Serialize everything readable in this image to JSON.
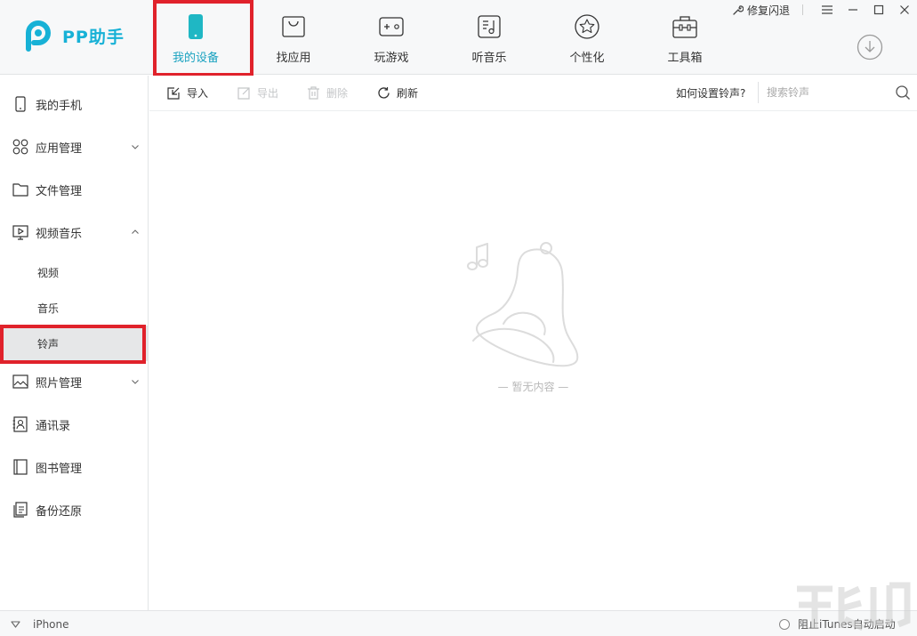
{
  "app": {
    "name": "PP助手"
  },
  "window": {
    "repair_label": "修复闪退"
  },
  "nav": [
    {
      "id": "my-device",
      "label": "我的设备",
      "icon": "phone-icon",
      "active": true
    },
    {
      "id": "find-apps",
      "label": "找应用",
      "icon": "shopping-bag-icon",
      "active": false
    },
    {
      "id": "games",
      "label": "玩游戏",
      "icon": "gamepad-icon",
      "active": false
    },
    {
      "id": "music",
      "label": "听音乐",
      "icon": "music-icon",
      "active": false
    },
    {
      "id": "personalize",
      "label": "个性化",
      "icon": "star-icon",
      "active": false
    },
    {
      "id": "toolbox",
      "label": "工具箱",
      "icon": "toolbox-icon",
      "active": false
    }
  ],
  "sidebar": {
    "items": [
      {
        "label": "我的手机",
        "icon": "phone-outline-icon"
      },
      {
        "label": "应用管理",
        "icon": "apps-grid-icon",
        "expandable": true
      },
      {
        "label": "文件管理",
        "icon": "folder-icon"
      },
      {
        "label": "视频音乐",
        "icon": "media-icon",
        "expanded": true
      },
      {
        "label": "照片管理",
        "icon": "image-icon",
        "expandable": true
      },
      {
        "label": "通讯录",
        "icon": "contacts-icon"
      },
      {
        "label": "图书管理",
        "icon": "book-icon"
      },
      {
        "label": "备份还原",
        "icon": "backup-icon"
      }
    ],
    "subitems": [
      {
        "label": "视频"
      },
      {
        "label": "音乐"
      },
      {
        "label": "铃声",
        "active": true
      }
    ]
  },
  "toolbar": {
    "import": "导入",
    "export": "导出",
    "delete": "删除",
    "refresh": "刷新",
    "howto": "如何设置铃声?",
    "search_placeholder": "搜索铃声"
  },
  "main": {
    "empty_text": "— 暂无内容 —"
  },
  "status": {
    "device": "iPhone",
    "itunes": "阻止iTunes自动启动"
  },
  "colors": {
    "accent": "#17b1d6",
    "active_nav": "#1aa2c0",
    "highlight": "#e0222b"
  }
}
